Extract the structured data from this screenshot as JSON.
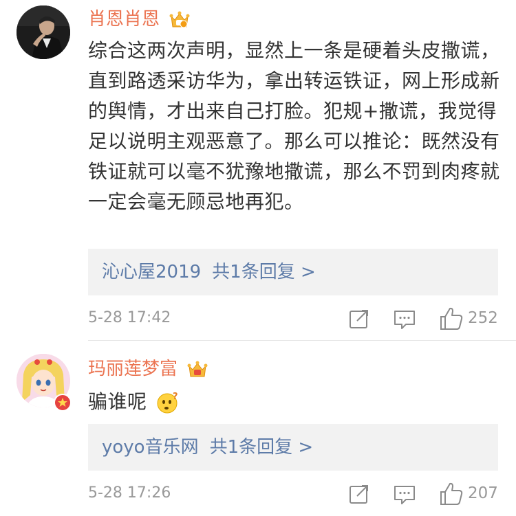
{
  "comments": [
    {
      "username": "肖恩肖恩",
      "text": "综合这两次声明，显然上一条是硬着头皮撒谎，直到路透采访华为，拿出转运铁证，网上形成新的舆情，才出来自己打脸。犯规+撒谎，我觉得足以说明主观恶意了。那么可以推论：既然没有铁证就可以毫不犹豫地撒谎，那么不罚到肉疼就一定会毫无顾忌地再犯。",
      "reply_user": "沁心屋2019",
      "reply_count": "共1条回复 >",
      "timestamp": "5-28 17:42",
      "likes": "252"
    },
    {
      "username": "玛丽莲梦富",
      "text": "骗谁呢",
      "reply_user": "yoyo音乐网",
      "reply_count": "共1条回复 >",
      "timestamp": "5-28 17:26",
      "likes": "207"
    }
  ],
  "colors": {
    "username": "#eb7350",
    "reply_link": "#5d7ba8",
    "body": "#333333",
    "meta": "#999999"
  },
  "icons": [
    "crown-vip-icon",
    "share-icon",
    "comment-icon",
    "like-icon",
    "thinking-emoji-icon",
    "verified-badge-icon"
  ]
}
